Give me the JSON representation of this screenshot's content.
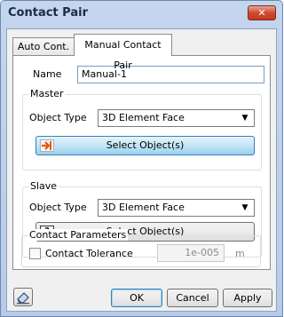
{
  "window": {
    "title": "Contact Pair",
    "close_label": "✕"
  },
  "tabs": [
    {
      "label": "Auto Cont."
    },
    {
      "label": "Manual Contact Pair"
    }
  ],
  "name": {
    "label": "Name",
    "value": "Manual-1"
  },
  "master": {
    "group_title": "Master",
    "object_type_label": "Object Type",
    "object_type_value": "3D Element Face",
    "select_button": "Select Object(s)"
  },
  "slave": {
    "group_title": "Slave",
    "object_type_label": "Object Type",
    "object_type_value": "3D Element Face",
    "select_button": "Select Object(s)"
  },
  "contact_parameters": {
    "group_title": "Contact Parameters",
    "tolerance_label": "Contact Tolerance",
    "tolerance_value": "1e-005",
    "tolerance_unit": "m"
  },
  "footer": {
    "ok": "OK",
    "cancel": "Cancel",
    "apply": "Apply"
  }
}
